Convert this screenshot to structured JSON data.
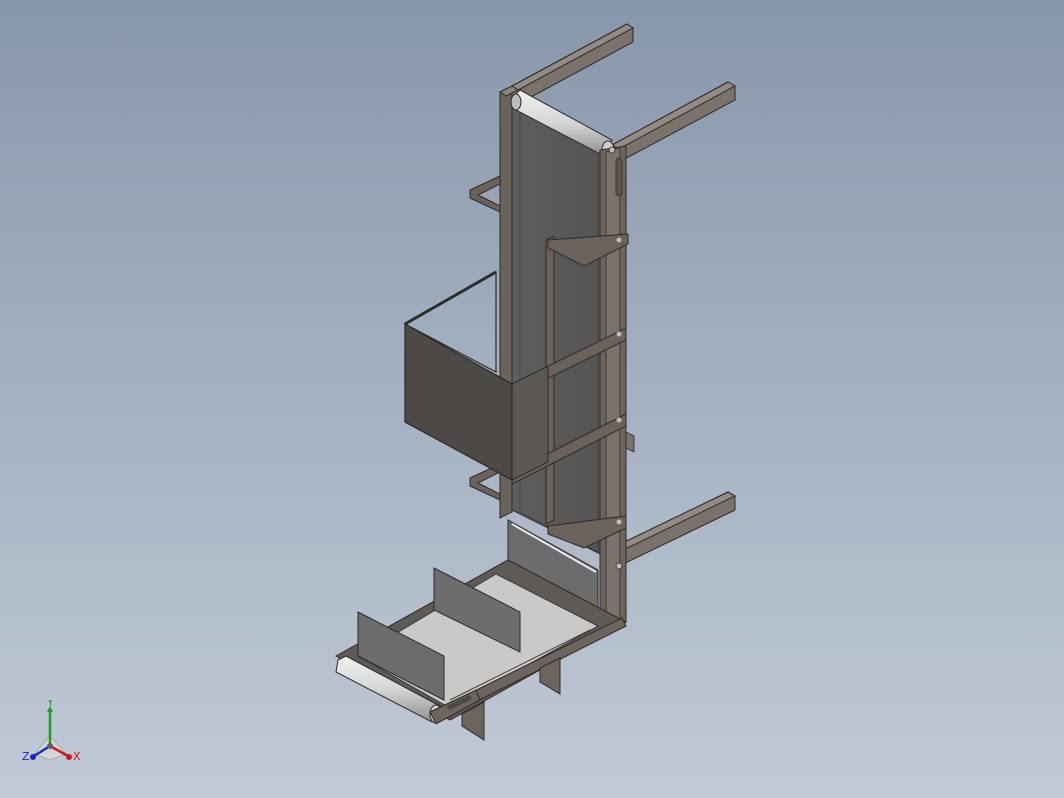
{
  "view": {
    "background_top": "#8797aa",
    "background_bottom": "#c1cad6"
  },
  "triad": {
    "x_label": "X",
    "y_label": "Y",
    "z_label": "Z",
    "x_color": "#d01818",
    "y_color": "#18a018",
    "z_color": "#1828c8"
  },
  "model": {
    "frame_color": "#6f6760",
    "belt_color": "#5a5a5a",
    "panel_color": "#4f4b48",
    "tray_color": "#c8c8c8",
    "roller_color": "#d8d8d8",
    "icon": "bucket-elevator-conveyor-model"
  }
}
